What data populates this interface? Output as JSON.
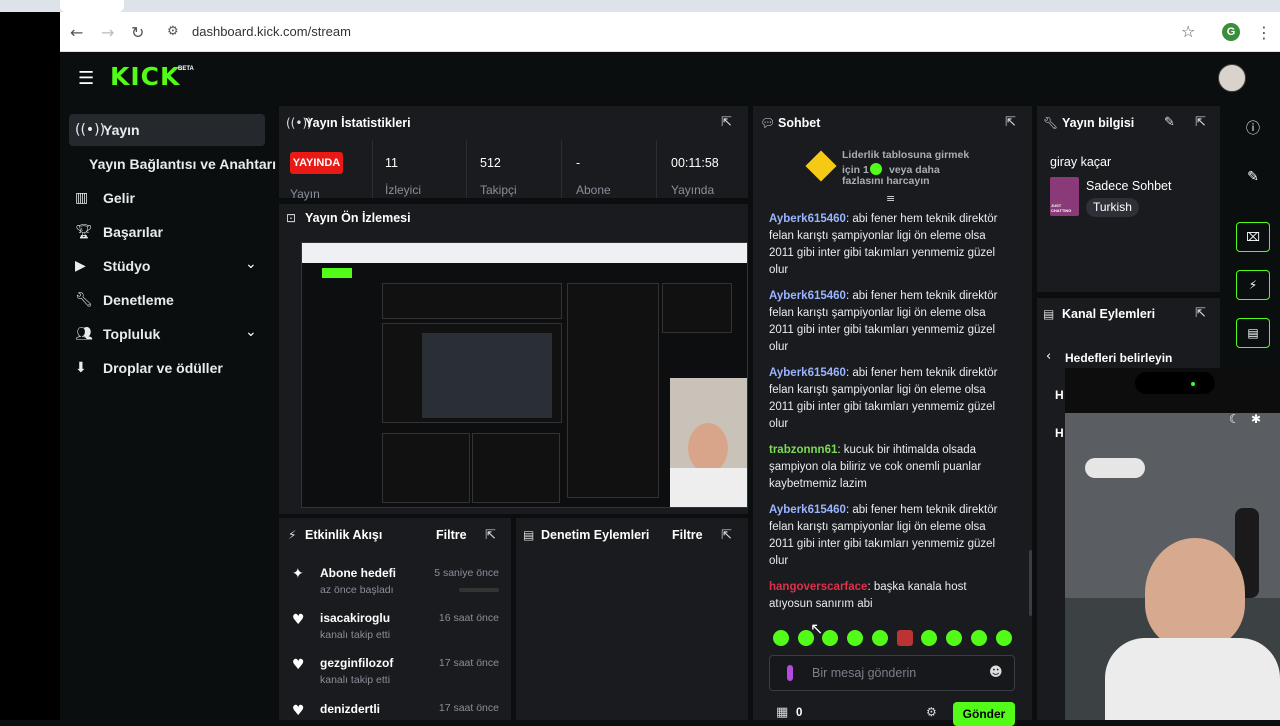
{
  "browser": {
    "url": "dashboard.kick.com/stream",
    "avatar_letter": "G"
  },
  "header": {
    "logo": "KICK",
    "logo_badge": "BETA"
  },
  "sidebar": {
    "items": [
      {
        "label": "Yayın",
        "icon": "broadcast-icon"
      },
      {
        "label": "Yayın Bağlantısı ve Anahtarı",
        "icon": ""
      },
      {
        "label": "Gelir",
        "icon": "chart-icon"
      },
      {
        "label": "Başarılar",
        "icon": "trophy-icon"
      },
      {
        "label": "Stüdyo",
        "icon": "video-icon"
      },
      {
        "label": "Denetleme",
        "icon": "wrench-icon"
      },
      {
        "label": "Topluluk",
        "icon": "users-icon"
      },
      {
        "label": "Droplar ve ödüller",
        "icon": "drops-icon"
      }
    ]
  },
  "stats": {
    "title": "Yayın İstatistikleri",
    "live_badge": "YAYINDA",
    "live_label": "Yayın",
    "viewers": "11",
    "viewers_label": "İzleyici",
    "followers": "512",
    "followers_label": "Takipçi",
    "subs": "-",
    "subs_label": "Abone",
    "uptime": "00:11:58",
    "uptime_label": "Yayında"
  },
  "preview": {
    "title": "Yayın Ön İzlemesi"
  },
  "activity": {
    "title": "Etkinlik Akışı",
    "filter": "Filtre",
    "items": [
      {
        "name": "Abone hedefi",
        "sub": "az önce başladı",
        "time": "5 saniye önce"
      },
      {
        "name": "isacakiroglu",
        "sub": "kanalı takip etti",
        "time": "16 saat önce"
      },
      {
        "name": "gezginfilozof",
        "sub": "kanalı takip etti",
        "time": "17 saat önce"
      },
      {
        "name": "denizdertli",
        "sub": "",
        "time": "17 saat önce"
      }
    ]
  },
  "moderation": {
    "title": "Denetim Eylemleri",
    "filter": "Filtre"
  },
  "chat": {
    "title": "Sohbet",
    "leaderboard_line1": "Liderlik tablosuna girmek",
    "leaderboard_line2": "için 1",
    "leaderboard_line3": "veya daha",
    "leaderboard_line4": "fazlasını harcayın",
    "messages": [
      {
        "user": "Ayberk615460",
        "color": "#9bb4ff",
        "text": "abi fener hem teknik direktör felan karıştı şampiyonlar ligi ön eleme olsa 2011 gibi inter gibi takımları yenmemiz güzel olur"
      },
      {
        "user": "Ayberk615460",
        "color": "#9bb4ff",
        "text": "abi fener hem teknik direktör felan karıştı şampiyonlar ligi ön eleme olsa 2011 gibi inter gibi takımları yenmemiz güzel olur"
      },
      {
        "user": "Ayberk615460",
        "color": "#9bb4ff",
        "text": "abi fener hem teknik direktör felan karıştı şampiyonlar ligi ön eleme olsa 2011 gibi inter gibi takımları yenmemiz güzel olur"
      },
      {
        "user": "trabzonnn61",
        "color": "#7cdb55",
        "text": "kucuk bir ihtimalda olsada şampiyon ola biliriz ve cok onemli puanlar kaybetmemiz lazim"
      },
      {
        "user": "Ayberk615460",
        "color": "#9bb4ff",
        "text": "abi fener hem teknik direktör felan karıştı şampiyonlar ligi ön eleme olsa 2011 gibi inter gibi takımları yenmemiz güzel olur"
      },
      {
        "user": "hangoverscarface",
        "color": "#e0304a",
        "text": "başka kanala host atıyosun sanırım abi"
      }
    ],
    "input_placeholder": "Bir mesaj gönderin",
    "points": "0",
    "send": "Gönder"
  },
  "info": {
    "title": "Yayın bilgisi",
    "stream_title": "giray kaçar",
    "category": "Sadece Sohbet",
    "tag": "Turkish",
    "category_art": "JUST CHATTING"
  },
  "channel_actions": {
    "title": "Kanal Eylemleri",
    "back_label": "Hedefleri belirleyin",
    "row1": "H",
    "row2": "H"
  },
  "colors": {
    "accent": "#53fc18",
    "live": "#e91916",
    "panel": "#191b1f"
  }
}
